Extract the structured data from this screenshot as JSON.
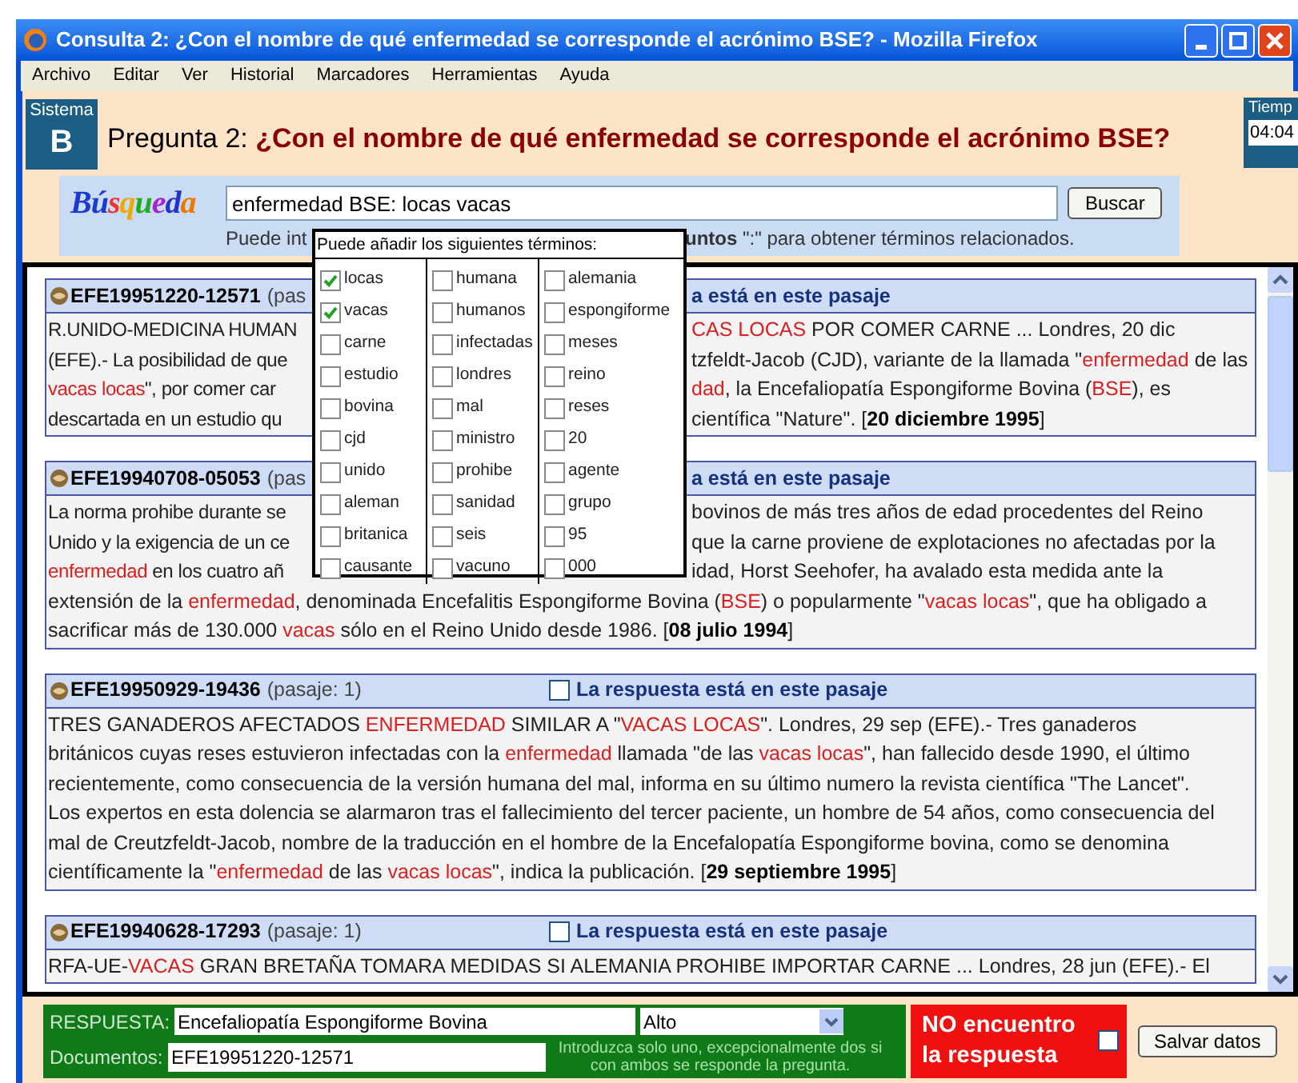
{
  "window": {
    "title": "Consulta 2: ¿Con el nombre de qué enfermedad se corresponde el acrónimo BSE? - Mozilla Firefox"
  },
  "menu": [
    {
      "label": "Archivo"
    },
    {
      "label": "Editar"
    },
    {
      "label": "Ver"
    },
    {
      "label": "Historial"
    },
    {
      "label": "Marcadores"
    },
    {
      "label": "Herramientas"
    },
    {
      "label": "Ayuda"
    }
  ],
  "system": {
    "label": "Sistema",
    "letter": "B"
  },
  "question": {
    "prefix": "Pregunta 2:",
    "text": "¿Con el nombre de qué enfermedad se corresponde el acrónimo BSE?"
  },
  "timer": {
    "label": "Tiemp",
    "value": "04:04"
  },
  "search": {
    "logo": "Búsqueda",
    "value": "enfermedad BSE: locas vacas",
    "button": "Buscar",
    "help_left": "Puede int",
    "help_right": "**untos** \":\" para obtener términos relacionados."
  },
  "popup": {
    "title": "Puede añadir los siguientes términos:",
    "columns": [
      [
        {
          "label": "locas",
          "checked": true
        },
        {
          "label": "vacas",
          "checked": true
        },
        {
          "label": "carne",
          "checked": false
        },
        {
          "label": "estudio",
          "checked": false
        },
        {
          "label": "bovina",
          "checked": false
        },
        {
          "label": "cjd",
          "checked": false
        },
        {
          "label": "unido",
          "checked": false
        },
        {
          "label": "aleman",
          "checked": false
        },
        {
          "label": "britanica",
          "checked": false
        },
        {
          "label": "causante",
          "checked": false
        }
      ],
      [
        {
          "label": "humana",
          "checked": false
        },
        {
          "label": "humanos",
          "checked": false
        },
        {
          "label": "infectadas",
          "checked": false
        },
        {
          "label": "londres",
          "checked": false
        },
        {
          "label": "mal",
          "checked": false
        },
        {
          "label": "ministro",
          "checked": false
        },
        {
          "label": "prohibe",
          "checked": false
        },
        {
          "label": "sanidad",
          "checked": false
        },
        {
          "label": "seis",
          "checked": false
        },
        {
          "label": "vacuno",
          "checked": false
        }
      ],
      [
        {
          "label": "alemania",
          "checked": false
        },
        {
          "label": "espongiforme",
          "checked": false
        },
        {
          "label": "meses",
          "checked": false
        },
        {
          "label": "reino",
          "checked": false
        },
        {
          "label": "reses",
          "checked": false
        },
        {
          "label": "20",
          "checked": false
        },
        {
          "label": "agente",
          "checked": false
        },
        {
          "label": "grupo",
          "checked": false
        },
        {
          "label": "95",
          "checked": false
        },
        {
          "label": "000",
          "checked": false
        }
      ]
    ]
  },
  "passages": [
    {
      "id": "EFE19951220-12571",
      "passage_label": "(pas",
      "answer_label": "a está en este pasaje",
      "lines": [
        {
          "left": "R.UNIDO-MEDICINA HUMAN",
          "right": "*CAS LOCAS* POR COMER CARNE ... Londres, 20 dic"
        },
        {
          "left": "(EFE).- La posibilidad de que",
          "right": "tzfeldt-Jacob (CJD), variante de la llamada \"*enfermedad* de las"
        },
        {
          "left": "*vacas locas*\", por comer car",
          "right": "*dad*, la Encefaliopatía Espongiforme Bovina (*BSE*), es"
        },
        {
          "left": "descartada en un estudio qu",
          "right": "científica \"Nature\". [**20 diciembre 1995**]"
        }
      ]
    },
    {
      "id": "EFE19940708-05053",
      "passage_label": "(pas",
      "answer_label": "a está en este pasaje",
      "lines": [
        {
          "left": "La norma prohibe durante se",
          "right": "bovinos de más tres años de edad procedentes del Reino"
        },
        {
          "left": "Unido y la exigencia de un ce",
          "right": "que la carne proviene de explotaciones no afectadas por la"
        },
        {
          "left": "*enfermedad* en los cuatro añ",
          "right": "idad, Horst Seehofer, ha avalado esta medida ante la"
        },
        {
          "text": "extensión de la *enfermedad*, denominada Encefalitis Espongiforme Bovina (*BSE*) o popularmente \"*vacas locas*\", que ha obligado a"
        },
        {
          "text": "sacrificar más de 130.000 *vacas* sólo en el Reino Unido desde 1986. [**08 julio 1994**]"
        }
      ]
    },
    {
      "id": "EFE19950929-19436",
      "passage_label": "(pasaje: 1)",
      "answer_label": "La respuesta está en este pasaje",
      "answer_checked": false,
      "lines": [
        {
          "text": "TRES GANADEROS AFECTADOS *ENFERMEDAD* SIMILAR A \"*VACAS LOCAS*\". Londres, 29 sep (EFE).- Tres ganaderos"
        },
        {
          "text": "británicos cuyas reses estuvieron infectadas con la *enfermedad* llamada \"de las *vacas locas*\", han fallecido desde 1990, el último"
        },
        {
          "text": "recientemente, como consecuencia de la versión humana del mal, informa en su último numero la revista científica \"The Lancet\"."
        },
        {
          "text": "Los expertos en esta dolencia se alarmaron tras el fallecimiento del tercer paciente, un hombre de 54 años, como consecuencia del"
        },
        {
          "text": "mal de Creutzfeldt-Jacob, nombre de la traducción en el hombre de la Encefalopatía Espongiforme bovina, como se denomina"
        },
        {
          "text": "científicamente la \"*enfermedad* de las *vacas locas*\", indica la publicación. [**29 septiembre 1995**]"
        }
      ]
    },
    {
      "id": "EFE19940628-17293",
      "passage_label": "(pasaje: 1)",
      "answer_label": "La respuesta está en este pasaje",
      "answer_checked": false,
      "lines": [
        {
          "text": "RFA-UE-*VACAS* GRAN BRETAÑA TOMARA MEDIDAS SI ALEMANIA PROHIBE IMPORTAR CARNE ... Londres, 28 jun (EFE).- El"
        }
      ]
    }
  ],
  "answer": {
    "label": "RESPUESTA:",
    "value": "Encefaliopatía Espongiforme Bovina",
    "confidence": "Alto",
    "docs_label": "Documentos:",
    "docs_value": "EFE19951220-12571",
    "note": "Introduzca solo uno, excepcionalmente dos si con ambos se responde la pregunta."
  },
  "not_found": {
    "label": "NO encuentro la respuesta",
    "checked": false
  },
  "save_button": "Salvar datos"
}
